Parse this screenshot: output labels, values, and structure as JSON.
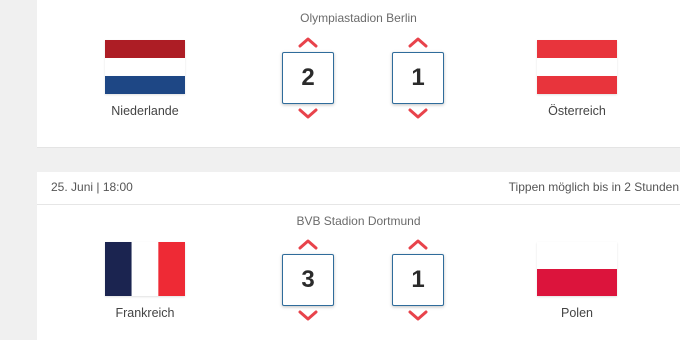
{
  "colors": {
    "accent_red": "#e8434b",
    "box_border": "#2f6c9b"
  },
  "matches": [
    {
      "venue": "Olympiastadion Berlin",
      "home": {
        "name": "Niederlande",
        "flag": "netherlands-flag"
      },
      "away": {
        "name": "Österreich",
        "flag": "austria-flag"
      },
      "home_score": "2",
      "away_score": "1"
    },
    {
      "date": "25. Juni | 18:00",
      "deadline": "Tippen möglich bis in 2 Stunden",
      "venue": "BVB Stadion Dortmund",
      "home": {
        "name": "Frankreich",
        "flag": "france-flag"
      },
      "away": {
        "name": "Polen",
        "flag": "poland-flag"
      },
      "home_score": "3",
      "away_score": "1"
    }
  ]
}
